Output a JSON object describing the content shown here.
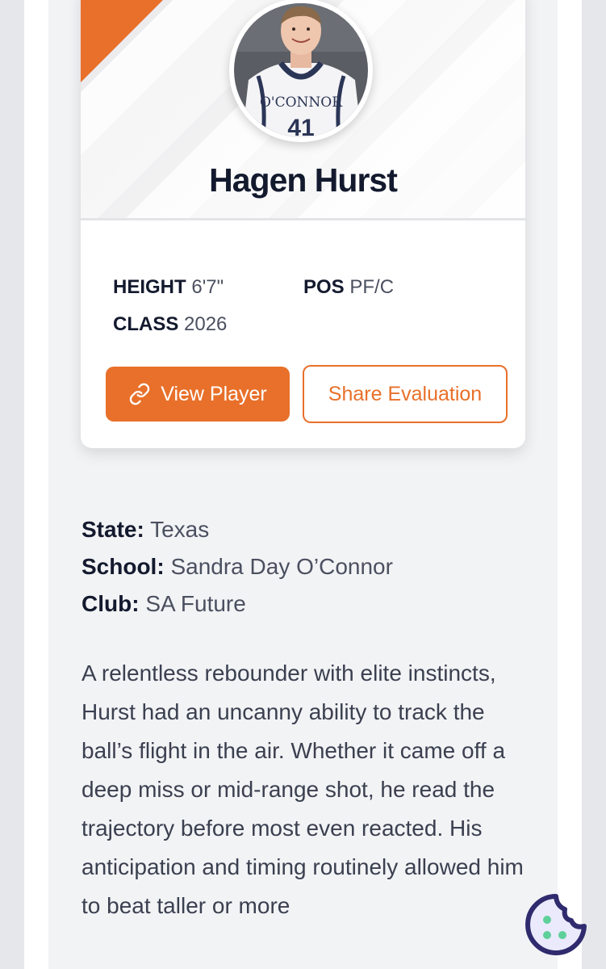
{
  "player": {
    "name": "Hagen Hurst",
    "jersey_text": "O'CONNOR",
    "jersey_number": "41"
  },
  "stats": {
    "height_label": "HEIGHT",
    "height_value": "6'7\"",
    "pos_label": "POS",
    "pos_value": "PF/C",
    "class_label": "CLASS",
    "class_value": "2026"
  },
  "buttons": {
    "view_player": "View Player",
    "share_evaluation": "Share Evaluation"
  },
  "info": {
    "state_label": "State:",
    "state_value": "Texas",
    "school_label": "School:",
    "school_value": "Sandra Day O’Connor",
    "club_label": "Club:",
    "club_value": "SA Future"
  },
  "bio": "A relentless rebounder with elite instincts, Hurst had an uncanny ability to track the ball’s flight in the air. Whether it came off a deep miss or mid-range shot, he read the trajectory before most even reacted. His anticipation and timing routinely allowed him to beat taller or more",
  "colors": {
    "accent": "#e8702a",
    "heading": "#141a2e",
    "body_text": "#3b4050",
    "cookie_fill": "#eaeafc",
    "cookie_stroke": "#2f2b6e",
    "cookie_dots": "#5fd09a"
  },
  "icons": {
    "link": "link-icon",
    "cookie": "cookie-icon"
  }
}
